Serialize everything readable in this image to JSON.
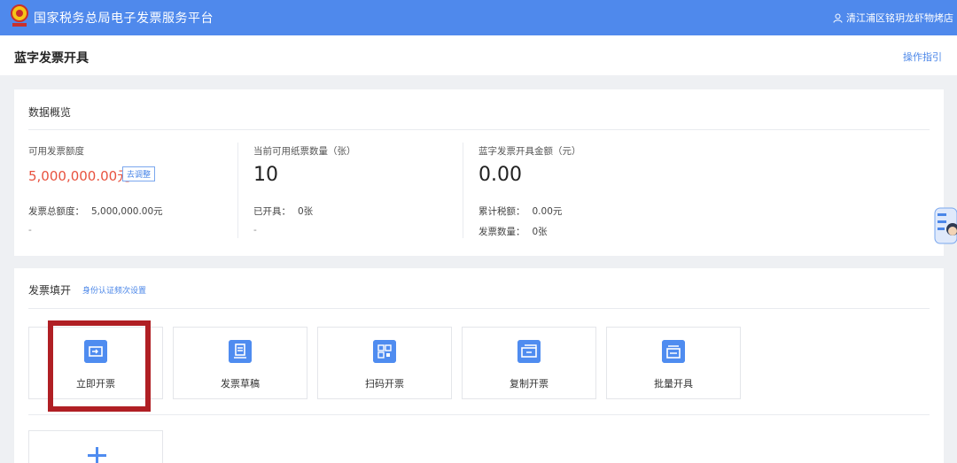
{
  "header": {
    "title": "国家税务总局电子发票服务平台",
    "user_name": "清江浦区铭玥龙虾物烤店"
  },
  "page": {
    "title": "蓝字发票开具",
    "guide_link": "操作指引"
  },
  "overview": {
    "title": "数据概览",
    "quota": {
      "label": "可用发票额度",
      "value": "5,000,000.00元",
      "adjust_label": "去调整",
      "total_label": "发票总额度：",
      "total_value": "5,000,000.00元",
      "extra": "-"
    },
    "paper": {
      "label": "当前可用纸票数量（张）",
      "value": "10",
      "issued_label": "已开具：",
      "issued_value": "0张",
      "extra": "-"
    },
    "amount": {
      "label": "蓝字发票开具金额（元）",
      "value": "0.00",
      "tax_label": "累计税额：",
      "tax_value": "0.00元",
      "count_label": "发票数量：",
      "count_value": "0张"
    }
  },
  "fill": {
    "title": "发票填开",
    "identity_link": "身份认证频次设置",
    "tiles": [
      {
        "label": "立即开票",
        "icon": "instant-invoice-icon"
      },
      {
        "label": "发票草稿",
        "icon": "draft-icon"
      },
      {
        "label": "扫码开票",
        "icon": "qr-code-icon"
      },
      {
        "label": "复制开票",
        "icon": "copy-invoice-icon"
      },
      {
        "label": "批量开具",
        "icon": "batch-invoice-icon"
      }
    ],
    "add_icon": "plus-icon"
  },
  "colors": {
    "header_bg": "#4f89ec",
    "accent": "#4a86e8",
    "quota_red": "#e8523f",
    "highlight_frame": "#b01f24"
  }
}
